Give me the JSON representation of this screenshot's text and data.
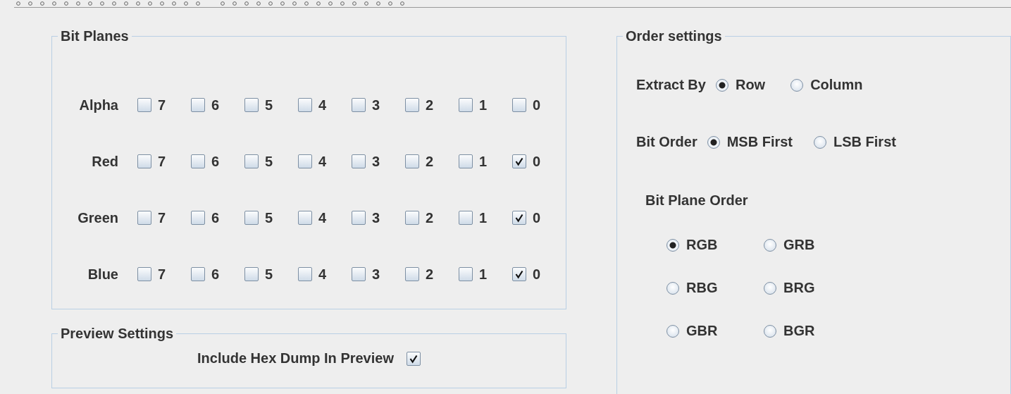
{
  "bit_planes": {
    "title": "Bit Planes",
    "channels": [
      {
        "name": "Alpha",
        "bits": [
          {
            "label": "7",
            "checked": false
          },
          {
            "label": "6",
            "checked": false
          },
          {
            "label": "5",
            "checked": false
          },
          {
            "label": "4",
            "checked": false
          },
          {
            "label": "3",
            "checked": false
          },
          {
            "label": "2",
            "checked": false
          },
          {
            "label": "1",
            "checked": false
          },
          {
            "label": "0",
            "checked": false
          }
        ]
      },
      {
        "name": "Red",
        "bits": [
          {
            "label": "7",
            "checked": false
          },
          {
            "label": "6",
            "checked": false
          },
          {
            "label": "5",
            "checked": false
          },
          {
            "label": "4",
            "checked": false
          },
          {
            "label": "3",
            "checked": false
          },
          {
            "label": "2",
            "checked": false
          },
          {
            "label": "1",
            "checked": false
          },
          {
            "label": "0",
            "checked": true
          }
        ]
      },
      {
        "name": "Green",
        "bits": [
          {
            "label": "7",
            "checked": false
          },
          {
            "label": "6",
            "checked": false
          },
          {
            "label": "5",
            "checked": false
          },
          {
            "label": "4",
            "checked": false
          },
          {
            "label": "3",
            "checked": false
          },
          {
            "label": "2",
            "checked": false
          },
          {
            "label": "1",
            "checked": false
          },
          {
            "label": "0",
            "checked": true
          }
        ]
      },
      {
        "name": "Blue",
        "bits": [
          {
            "label": "7",
            "checked": false
          },
          {
            "label": "6",
            "checked": false
          },
          {
            "label": "5",
            "checked": false
          },
          {
            "label": "4",
            "checked": false
          },
          {
            "label": "3",
            "checked": false
          },
          {
            "label": "2",
            "checked": false
          },
          {
            "label": "1",
            "checked": false
          },
          {
            "label": "0",
            "checked": true
          }
        ]
      }
    ]
  },
  "preview_settings": {
    "title": "Preview Settings",
    "hex_dump": {
      "label": "Include Hex Dump In Preview",
      "checked": true
    }
  },
  "order_settings": {
    "title": "Order settings",
    "extract_by": {
      "label": "Extract By",
      "options": [
        {
          "label": "Row",
          "selected": true
        },
        {
          "label": "Column",
          "selected": false
        }
      ]
    },
    "bit_order": {
      "label": "Bit Order",
      "options": [
        {
          "label": "MSB First",
          "selected": true
        },
        {
          "label": "LSB First",
          "selected": false
        }
      ]
    },
    "bit_plane_order": {
      "title": "Bit Plane Order",
      "options": [
        {
          "label": "RGB",
          "selected": true
        },
        {
          "label": "GRB",
          "selected": false
        },
        {
          "label": "RBG",
          "selected": false
        },
        {
          "label": "BRG",
          "selected": false
        },
        {
          "label": "GBR",
          "selected": false
        },
        {
          "label": "BGR",
          "selected": false
        }
      ]
    }
  }
}
